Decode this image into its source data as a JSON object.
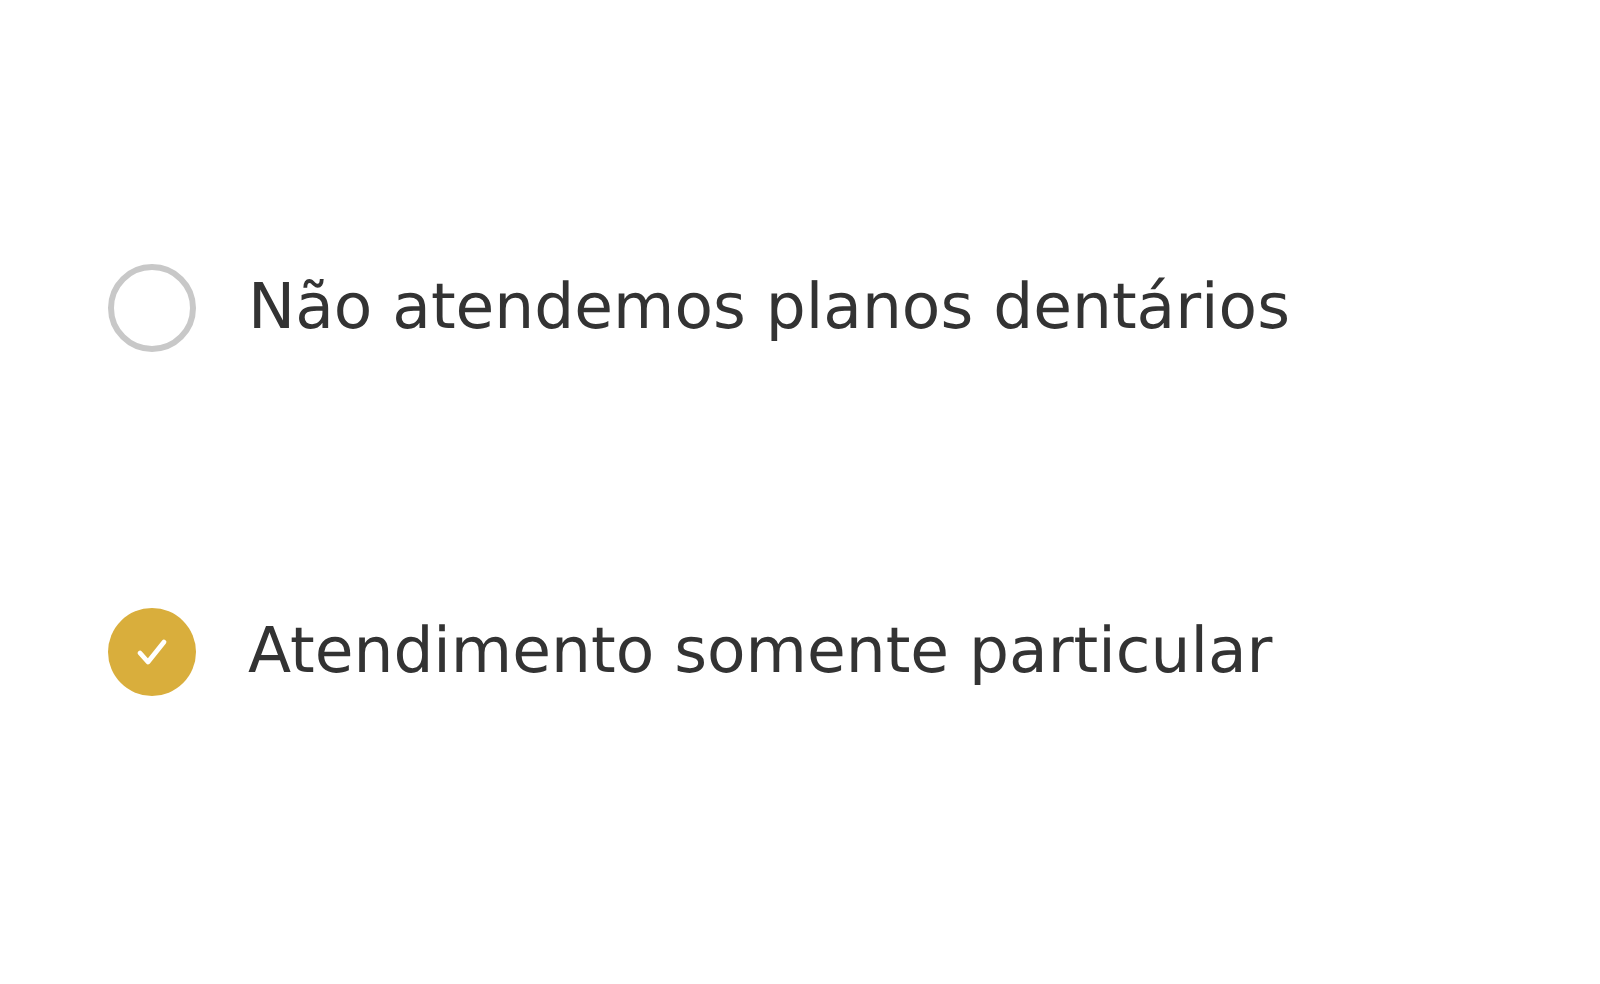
{
  "options": [
    {
      "label": "Não atendemos planos dentários",
      "selected": false
    },
    {
      "label": "Atendimento somente particular",
      "selected": true
    }
  ]
}
